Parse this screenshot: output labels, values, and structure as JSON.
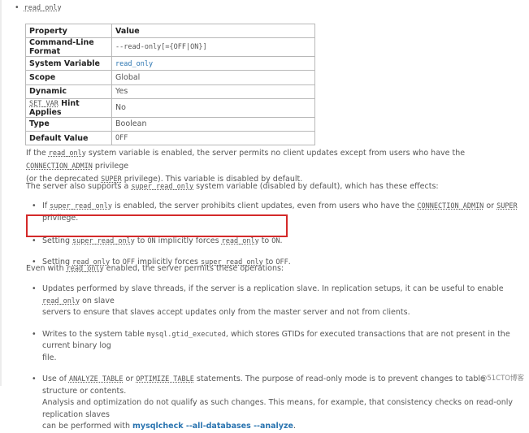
{
  "top_item": {
    "label": "read_only"
  },
  "table": {
    "headers": [
      "Property",
      "Value"
    ],
    "rows": [
      {
        "key": "Command-Line Format",
        "value": "--read-only[={OFF|ON}]"
      },
      {
        "key": "System Variable",
        "value": "read_only"
      },
      {
        "key": "Scope",
        "value": "Global"
      },
      {
        "key": "Dynamic",
        "value": "Yes"
      },
      {
        "key_code": "SET_VAR",
        "key_rest": " Hint Applies",
        "value": "No"
      },
      {
        "key": "Type",
        "value": "Boolean"
      },
      {
        "key": "Default Value",
        "value": "OFF"
      }
    ]
  },
  "p1": {
    "a": "If the ",
    "c1": "read_only",
    "b": " system variable is enabled, the server permits no client updates except from users who have the ",
    "c2": "CONNECTION_ADMIN",
    "c": " privilege",
    "d": "(or the deprecated ",
    "c3": "SUPER",
    "e": " privilege). This variable is disabled by default."
  },
  "p2": {
    "a": "The server also supports a ",
    "c1": "super_read_only",
    "b": " system variable (disabled by default), which has these effects:"
  },
  "bullets1": [
    {
      "a": "If ",
      "c1": "super_read_only",
      "b": " is enabled, the server prohibits client updates, even from users who have the ",
      "c2": "CONNECTION_ADMIN",
      "c": " or ",
      "c3": "SUPER",
      "d": " privilege."
    },
    {
      "a": "Setting ",
      "c1": "super_read_only",
      "b": " to ",
      "c2": "ON",
      "c": " implicitly forces ",
      "c3": "read_only",
      "d": " to ",
      "c4": "ON",
      "e": "."
    },
    {
      "a": "Setting ",
      "c1": "read_only",
      "b": " to ",
      "c2": "OFF",
      "c": " implicitly forces ",
      "c3": "super_read_only",
      "d": " to ",
      "c4": "OFF",
      "e": "."
    }
  ],
  "p3": {
    "a": "Even with ",
    "c1": "read_only",
    "b": " enabled, the server permits these operations:"
  },
  "bullets2": [
    {
      "l1": "Updates performed by slave threads, if the server is a replication slave. In replication setups, it can be useful to enable ",
      "c1": "read_only",
      "l1b": " on slave",
      "l2": "servers to ensure that slaves accept updates only from the master server and not from clients."
    },
    {
      "l1": "Writes to the system table ",
      "c1": "mysql.gtid_executed",
      "l1b": ", which stores GTIDs for executed transactions that are not present in the current binary log",
      "l2": "file."
    },
    {
      "a": "Use of ",
      "c1": "ANALYZE TABLE",
      "b": " or ",
      "c2": "OPTIMIZE TABLE",
      "c": " statements. The purpose of read-only mode is to prevent changes to table structure or contents.",
      "l2": "Analysis and optimization do not qualify as such changes. This means, for example, that consistency checks on read-only replication slaves",
      "l3a": "can be performed with ",
      "l3link": "mysqlcheck --all-databases --analyze",
      "l3b": "."
    }
  ],
  "watermark": "@51CTO博客"
}
